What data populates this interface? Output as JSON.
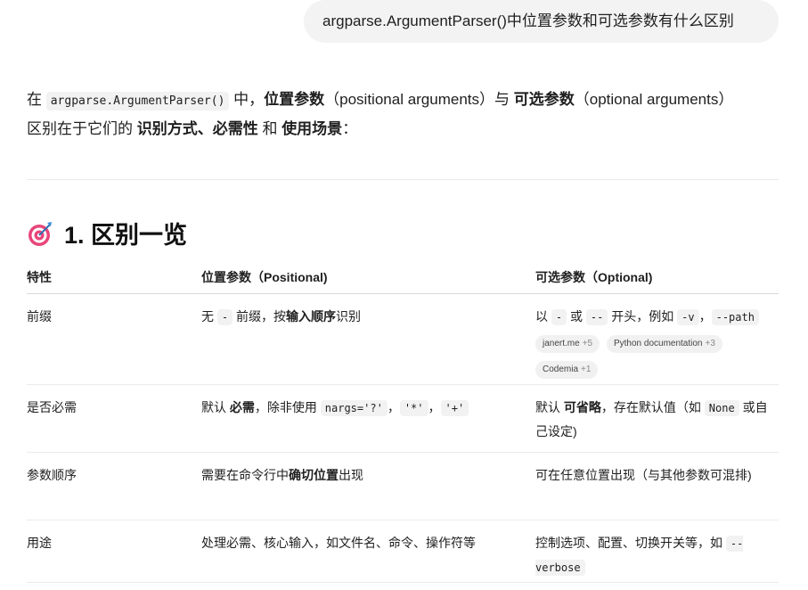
{
  "user_message": "argparse.ArgumentParser()中位置参数和可选参数有什么区别",
  "intro": {
    "p1": "在 ",
    "code1": "argparse.ArgumentParser()",
    "p2": " 中，",
    "b1": "位置参数",
    "p3": "（positional arguments）与 ",
    "b2": "可选参数",
    "p4": "（optional arguments）区别在于它们的 ",
    "b3": "识别方式、必需性",
    "p5": " 和 ",
    "b4": "使用场景",
    "p6": "："
  },
  "section": {
    "icon": "target-icon",
    "title": "1. 区别一览"
  },
  "table": {
    "headers": [
      "特性",
      "位置参数（Positional)",
      "可选参数（Optional)"
    ],
    "rows": [
      {
        "feature": "前缀",
        "positional": {
          "a": "无 ",
          "code1": "-",
          "b": " 前缀，按",
          "bold": "输入顺序",
          "c": "识别"
        },
        "optional": {
          "a": "以 ",
          "code1": "-",
          "b": " 或 ",
          "code2": "--",
          "c": " 开头，例如 ",
          "code3": "-v",
          "d": "，",
          "code4": "--path"
        },
        "sources": [
          {
            "label": "janert.me",
            "count": "+5"
          },
          {
            "label": "Python documentation",
            "count": "+3"
          },
          {
            "label": "Codemia",
            "count": "+1"
          }
        ]
      },
      {
        "feature": "是否必需",
        "positional": {
          "a": "默认 ",
          "bold": "必需",
          "b": "，除非使用 ",
          "code1": "nargs='?'",
          "c": "，",
          "code2": "'*'",
          "d": "，",
          "code3": "'+'"
        },
        "optional": {
          "a": "默认 ",
          "bold": "可省略",
          "b": "，存在默认值（如 ",
          "code1": "None",
          "c": " 或自己设定)"
        }
      },
      {
        "feature": "参数顺序",
        "positional": {
          "a": "需要在命令行中",
          "bold": "确切位置",
          "b": "出现"
        },
        "optional": {
          "a": "可在任意位置出现（与其他参数可混排)"
        }
      },
      {
        "feature": "用途",
        "positional": {
          "a": "处理必需、核心输入，如文件名、命令、操作符等"
        },
        "optional": {
          "a": "控制选项、配置、切换开关等，如 ",
          "code1": "--verbose"
        }
      }
    ]
  }
}
